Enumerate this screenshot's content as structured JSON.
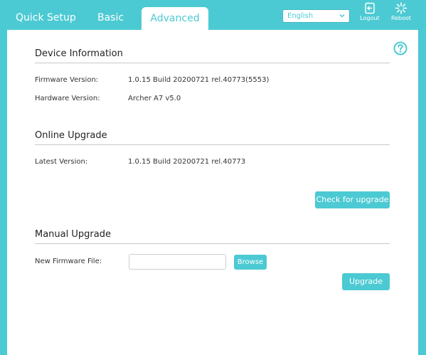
{
  "nav": {
    "tabs": [
      {
        "label": "Quick Setup"
      },
      {
        "label": "Basic"
      },
      {
        "label": "Advanced"
      }
    ],
    "language": "English",
    "logout_label": "Logout",
    "reboot_label": "Reboot"
  },
  "device_info": {
    "title": "Device Information",
    "firmware_label": "Firmware Version:",
    "firmware_value": "1.0.15 Build 20200721 rel.40773(5553)",
    "hardware_label": "Hardware Version:",
    "hardware_value": "Archer A7 v5.0"
  },
  "online_upgrade": {
    "title": "Online Upgrade",
    "latest_label": "Latest Version:",
    "latest_value": "1.0.15 Build 20200721 rel.40773",
    "check_button": "Check for upgrade"
  },
  "manual_upgrade": {
    "title": "Manual Upgrade",
    "file_label": "New Firmware File:",
    "file_value": "",
    "browse_button": "Browse",
    "upgrade_button": "Upgrade"
  },
  "colors": {
    "accent": "#4ccad3",
    "panel": "#ffffff",
    "rule": "#c8c8c8"
  },
  "icons": [
    "logout-icon",
    "reboot-icon",
    "help-icon",
    "chevron-down-icon"
  ]
}
